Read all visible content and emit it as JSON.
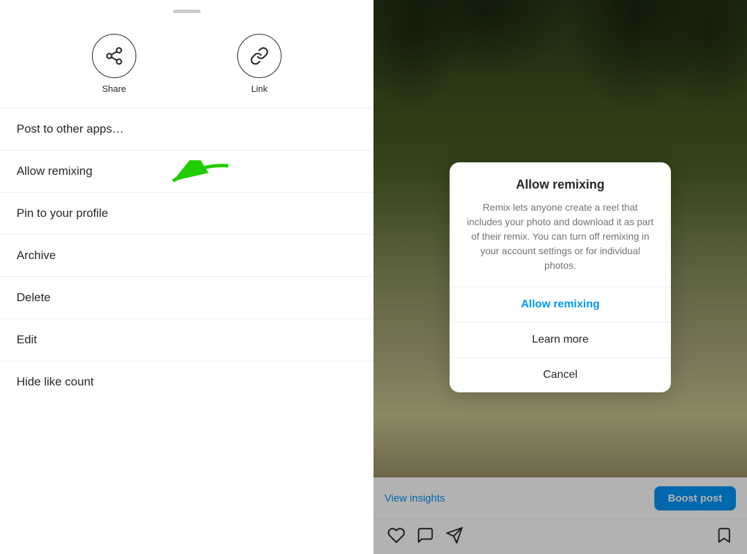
{
  "left": {
    "drag_handle": "",
    "icons": [
      {
        "id": "share",
        "label": "Share"
      },
      {
        "id": "link",
        "label": "Link"
      }
    ],
    "menu_items": [
      {
        "id": "post-to-other-apps",
        "label": "Post to other apps…"
      },
      {
        "id": "allow-remixing",
        "label": "Allow remixing"
      },
      {
        "id": "pin-to-profile",
        "label": "Pin to your profile"
      },
      {
        "id": "archive",
        "label": "Archive"
      },
      {
        "id": "delete",
        "label": "Delete"
      },
      {
        "id": "edit",
        "label": "Edit"
      },
      {
        "id": "hide-like-count",
        "label": "Hide like count"
      }
    ]
  },
  "right": {
    "bottom_bar": {
      "view_insights": "View insights",
      "boost_post": "Boost post"
    },
    "dialog": {
      "title": "Allow remixing",
      "body": "Remix lets anyone create a reel that includes your photo and download it as part of their remix. You can turn off remixing in your account settings or for individual photos.",
      "actions": [
        {
          "id": "allow-remixing-btn",
          "label": "Allow remixing",
          "style": "primary"
        },
        {
          "id": "learn-more-btn",
          "label": "Learn more",
          "style": "normal"
        },
        {
          "id": "cancel-btn",
          "label": "Cancel",
          "style": "normal"
        }
      ]
    }
  }
}
